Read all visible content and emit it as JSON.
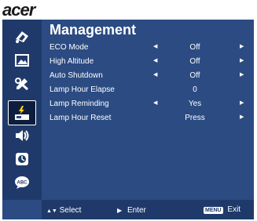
{
  "brand": {
    "logo_text": "acer"
  },
  "menu": {
    "title": "Management",
    "items": [
      {
        "label": "ECO Mode",
        "value": "Off",
        "has_left_arrow": true,
        "has_right_arrow": true
      },
      {
        "label": "High Altitude",
        "value": "Off",
        "has_left_arrow": true,
        "has_right_arrow": true
      },
      {
        "label": "Auto Shutdown",
        "value": "Off",
        "has_left_arrow": true,
        "has_right_arrow": true
      },
      {
        "label": "Lamp Hour Elapse",
        "value": "0",
        "has_left_arrow": false,
        "has_right_arrow": false
      },
      {
        "label": "Lamp Reminding",
        "value": "Yes",
        "has_left_arrow": true,
        "has_right_arrow": true
      },
      {
        "label": "Lamp Hour Reset",
        "value": "Press",
        "has_left_arrow": false,
        "has_right_arrow": true
      }
    ]
  },
  "sidebar": {
    "icons": [
      {
        "name": "color-settings-icon"
      },
      {
        "name": "image-settings-icon"
      },
      {
        "name": "setting-tools-icon"
      },
      {
        "name": "management-icon",
        "active": true
      },
      {
        "name": "audio-icon"
      },
      {
        "name": "timer-icon"
      },
      {
        "name": "language-icon"
      }
    ]
  },
  "footer": {
    "select_label": "Select",
    "enter_label": "Enter",
    "menu_key": "MENU",
    "exit_label": "Exit"
  },
  "colors": {
    "panel": "#2b4b82",
    "sidebar": "#1f3a6a",
    "text": "#ffffff"
  }
}
